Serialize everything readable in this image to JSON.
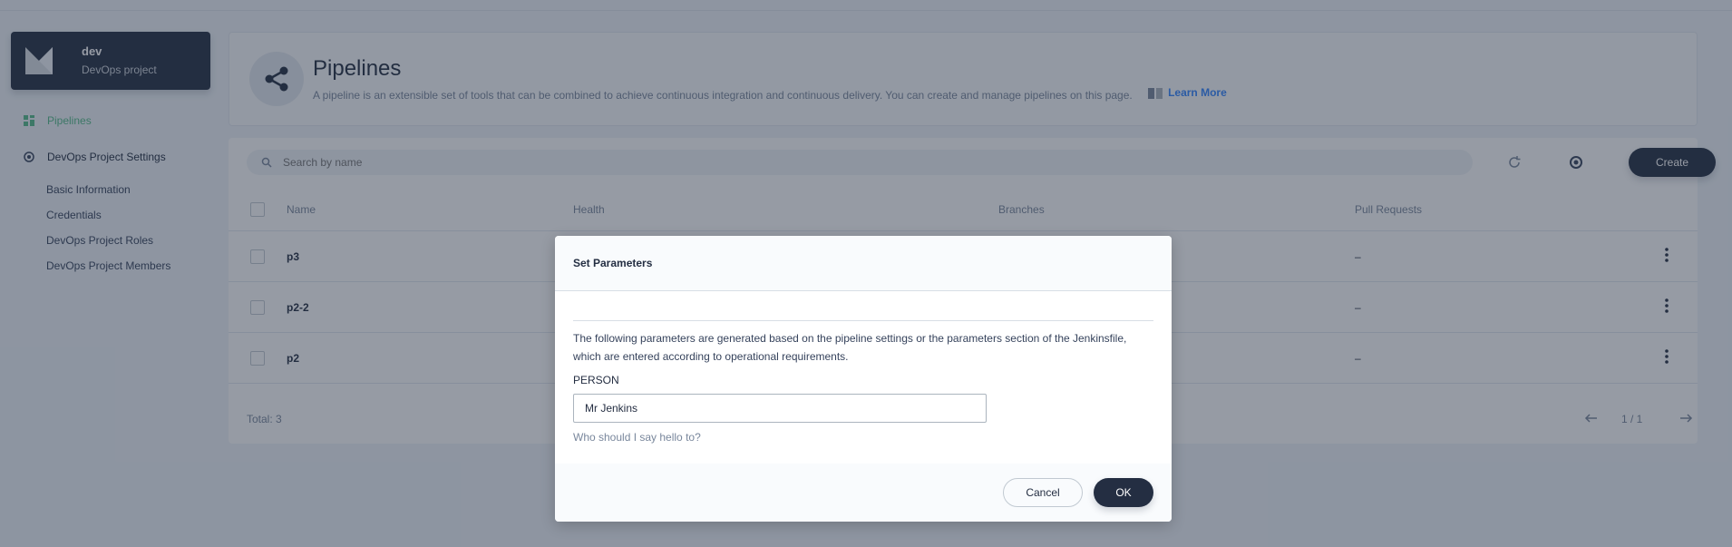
{
  "sidebar": {
    "project_name": "dev",
    "project_type": "DevOps project",
    "nav": {
      "pipelines": "Pipelines",
      "settings": "DevOps Project Settings",
      "sub_items": [
        "Basic Information",
        "Credentials",
        "DevOps Project Roles",
        "DevOps Project Members"
      ]
    }
  },
  "banner": {
    "title": "Pipelines",
    "description": "A pipeline is an extensible set of tools that can be combined to achieve continuous integration and continuous delivery. You can create and manage pipelines on this page.",
    "learn_more": "Learn More"
  },
  "toolbar": {
    "search_placeholder": "Search by name",
    "create_label": "Create"
  },
  "table": {
    "columns": [
      "Name",
      "Health",
      "Branches",
      "Pull Requests"
    ],
    "rows": [
      {
        "name": "p3",
        "pull_requests": "–"
      },
      {
        "name": "p2-2",
        "pull_requests": "–"
      },
      {
        "name": "p2",
        "pull_requests": "–"
      }
    ],
    "total": "Total: 3",
    "page": "1 / 1"
  },
  "modal": {
    "title": "Set Parameters",
    "description": "The following parameters are generated based on the pipeline settings or the parameters section of the Jenkinsfile, which are entered according to operational requirements.",
    "param_label": "PERSON",
    "param_value": "Mr Jenkins",
    "param_help": "Who should I say hello to?",
    "cancel_label": "Cancel",
    "ok_label": "OK"
  },
  "colors": {
    "accent_green": "#55bc8a",
    "dark": "#242e42",
    "link_blue": "#3385ff"
  }
}
